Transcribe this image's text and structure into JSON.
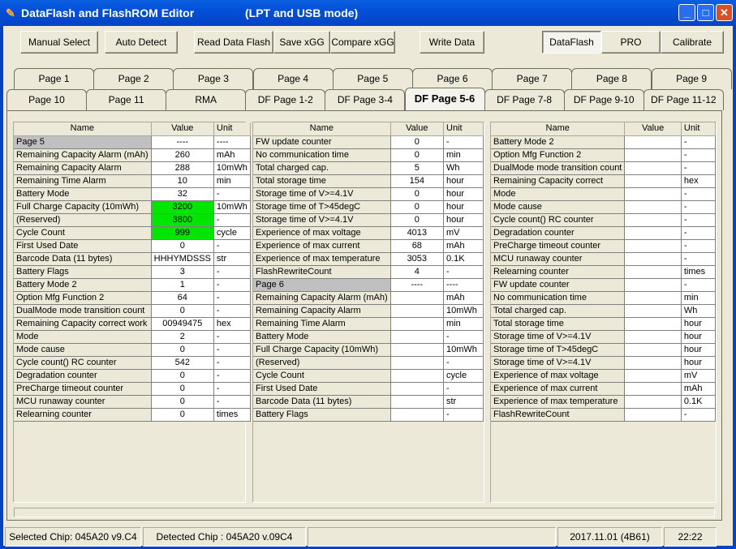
{
  "window": {
    "title": "DataFlash  and  FlashROM   Editor",
    "subtitle": "(LPT and USB mode)",
    "minimize": "_",
    "maximize": "□",
    "close": "✕"
  },
  "toolbar": {
    "manual_select": "Manual Select",
    "auto_detect": "Auto Detect",
    "read_data_flash": "Read Data Flash",
    "save_xgg": "Save xGG",
    "compare_xgg": "Compare xGG",
    "write_data": "Write Data",
    "dataflash": "DataFlash",
    "pro": "PRO",
    "calibrate": "Calibrate"
  },
  "tabs_row1": [
    "Page 1",
    "Page 2",
    "Page 3",
    "Page 4",
    "Page 5",
    "Page 6",
    "Page 7",
    "Page 8",
    "Page 9"
  ],
  "tabs_row2": [
    "Page 10",
    "Page 11",
    "RMA",
    "DF Page 1-2",
    "DF Page 3-4",
    "DF Page 5-6",
    "DF Page 7-8",
    "DF Page 9-10",
    "DF Page 11-12"
  ],
  "active_tab": "DF Page 5-6",
  "columns": {
    "name": "Name",
    "value": "Value",
    "unit": "Unit"
  },
  "highlight_color": "#00e600",
  "grids": [
    [
      {
        "name": "Page 5",
        "value": "----",
        "unit": "----",
        "section": true
      },
      {
        "name": "Remaining Capacity Alarm (mAh)",
        "value": "260",
        "unit": "mAh"
      },
      {
        "name": "Remaining Capacity Alarm",
        "value": "288",
        "unit": "10mWh"
      },
      {
        "name": "Remaining Time Alarm",
        "value": "10",
        "unit": "min"
      },
      {
        "name": "Battery Mode",
        "value": "32",
        "unit": "-"
      },
      {
        "name": "Full Charge Capacity (10mWh)",
        "value": "3200",
        "unit": "10mWh",
        "highlight": true
      },
      {
        "name": "(Reserved)",
        "value": "3800",
        "unit": "-",
        "highlight": true
      },
      {
        "name": "Cycle Count",
        "value": "999",
        "unit": "cycle",
        "highlight": true
      },
      {
        "name": "First Used Date",
        "value": "0",
        "unit": "-"
      },
      {
        "name": "Barcode Data (11 bytes)",
        "value": "HHHYMDSSS",
        "unit": "str"
      },
      {
        "name": "Battery Flags",
        "value": "3",
        "unit": "-"
      },
      {
        "name": "Battery Mode 2",
        "value": "1",
        "unit": "-"
      },
      {
        "name": "Option Mfg Function 2",
        "value": "64",
        "unit": "-"
      },
      {
        "name": "DualMode mode transition count",
        "value": "0",
        "unit": "-"
      },
      {
        "name": "Remaining Capacity correct work",
        "value": "00949475",
        "unit": "hex"
      },
      {
        "name": "Mode",
        "value": "2",
        "unit": "-"
      },
      {
        "name": "Mode cause",
        "value": "0",
        "unit": "-"
      },
      {
        "name": "Cycle count() RC counter",
        "value": "542",
        "unit": "-"
      },
      {
        "name": "Degradation counter",
        "value": "0",
        "unit": "-"
      },
      {
        "name": "PreCharge timeout counter",
        "value": "0",
        "unit": "-"
      },
      {
        "name": "MCU runaway counter",
        "value": "0",
        "unit": "-"
      },
      {
        "name": "Relearning counter",
        "value": "0",
        "unit": "times"
      }
    ],
    [
      {
        "name": "FW update counter",
        "value": "0",
        "unit": "-"
      },
      {
        "name": "No communication time",
        "value": "0",
        "unit": "min"
      },
      {
        "name": "Total charged cap.",
        "value": "5",
        "unit": "Wh"
      },
      {
        "name": "Total storage time",
        "value": "154",
        "unit": "hour"
      },
      {
        "name": "Storage time of V>=4.1V",
        "value": "0",
        "unit": "hour"
      },
      {
        "name": "Storage time of T>45degC",
        "value": "0",
        "unit": "hour"
      },
      {
        "name": "Storage time of V>=4.1V",
        "value": "0",
        "unit": "hour"
      },
      {
        "name": "Experience of max voltage",
        "value": "4013",
        "unit": "mV"
      },
      {
        "name": "Experience of max current",
        "value": "68",
        "unit": "mAh"
      },
      {
        "name": "Experience of max temperature",
        "value": "3053",
        "unit": "0.1K"
      },
      {
        "name": "FlashRewriteCount",
        "value": "4",
        "unit": "-"
      },
      {
        "name": "Page 6",
        "value": "----",
        "unit": "----",
        "section": true
      },
      {
        "name": "Remaining Capacity Alarm (mAh)",
        "value": "",
        "unit": "mAh"
      },
      {
        "name": "Remaining Capacity Alarm",
        "value": "",
        "unit": "10mWh"
      },
      {
        "name": "Remaining Time Alarm",
        "value": "",
        "unit": "min"
      },
      {
        "name": "Battery Mode",
        "value": "",
        "unit": "-"
      },
      {
        "name": "Full Charge Capacity (10mWh)",
        "value": "",
        "unit": "10mWh"
      },
      {
        "name": "(Reserved)",
        "value": "",
        "unit": "-"
      },
      {
        "name": "Cycle Count",
        "value": "",
        "unit": "cycle"
      },
      {
        "name": "First Used Date",
        "value": "",
        "unit": "-"
      },
      {
        "name": "Barcode Data (11 bytes)",
        "value": "",
        "unit": "str"
      },
      {
        "name": "Battery Flags",
        "value": "",
        "unit": "-"
      }
    ],
    [
      {
        "name": "Battery Mode 2",
        "value": "",
        "unit": "-"
      },
      {
        "name": "Option Mfg Function 2",
        "value": "",
        "unit": "-"
      },
      {
        "name": "DualMode mode transition count",
        "value": "",
        "unit": "-"
      },
      {
        "name": "Remaining Capacity correct",
        "value": "",
        "unit": "hex"
      },
      {
        "name": "Mode",
        "value": "",
        "unit": "-"
      },
      {
        "name": "Mode cause",
        "value": "",
        "unit": "-"
      },
      {
        "name": "Cycle count() RC counter",
        "value": "",
        "unit": "-"
      },
      {
        "name": "Degradation counter",
        "value": "",
        "unit": "-"
      },
      {
        "name": "PreCharge timeout counter",
        "value": "",
        "unit": "-"
      },
      {
        "name": "MCU runaway counter",
        "value": "",
        "unit": "-"
      },
      {
        "name": "Relearning counter",
        "value": "",
        "unit": "times"
      },
      {
        "name": "FW update counter",
        "value": "",
        "unit": "-"
      },
      {
        "name": "No communication time",
        "value": "",
        "unit": "min"
      },
      {
        "name": "Total charged cap.",
        "value": "",
        "unit": "Wh"
      },
      {
        "name": "Total storage time",
        "value": "",
        "unit": "hour"
      },
      {
        "name": "Storage time of V>=4.1V",
        "value": "",
        "unit": "hour"
      },
      {
        "name": "Storage time of T>45degC",
        "value": "",
        "unit": "hour"
      },
      {
        "name": "Storage time of V>=4.1V",
        "value": "",
        "unit": "hour"
      },
      {
        "name": "Experience of max voltage",
        "value": "",
        "unit": "mV"
      },
      {
        "name": "Experience of max current",
        "value": "",
        "unit": "mAh"
      },
      {
        "name": "Experience of max temperature",
        "value": "",
        "unit": "0.1K"
      },
      {
        "name": "FlashRewriteCount",
        "value": "",
        "unit": "-"
      }
    ]
  ],
  "statusbar": {
    "selected_chip": "Selected Chip:  045A20 v9.C4",
    "detected_chip": "Detected Chip : 045A20  v.09C4",
    "empty": "",
    "date": "2017.11.01  (4B61)",
    "time": "22:22"
  }
}
